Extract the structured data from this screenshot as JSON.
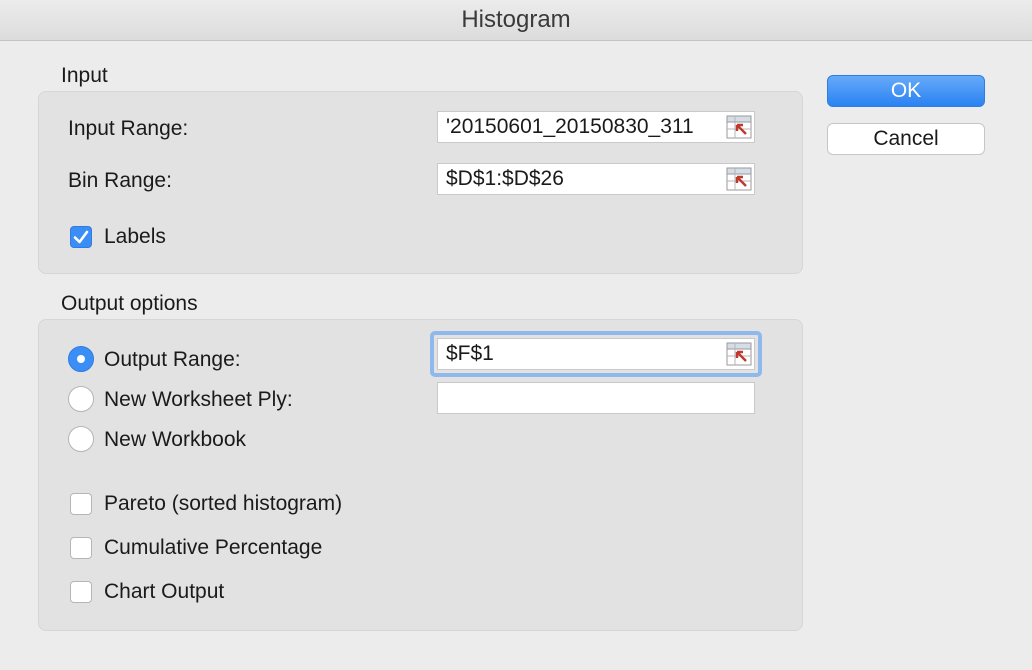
{
  "window": {
    "title": "Histogram"
  },
  "buttons": {
    "ok": "OK",
    "cancel": "Cancel"
  },
  "input_section": {
    "label": "Input",
    "input_range_label": "Input Range:",
    "input_range_value": "'20150601_20150830_311",
    "bin_range_label": "Bin Range:",
    "bin_range_value": "$D$1:$D$26",
    "labels_checkbox": {
      "label": "Labels",
      "checked": true
    }
  },
  "output_section": {
    "label": "Output options",
    "output_range": {
      "label": "Output Range:",
      "selected": true,
      "value": "$F$1"
    },
    "new_worksheet_ply": {
      "label": "New Worksheet Ply:",
      "selected": false,
      "value": ""
    },
    "new_workbook": {
      "label": "New Workbook",
      "selected": false
    },
    "pareto": {
      "label": "Pareto (sorted histogram)",
      "checked": false
    },
    "cumulative_percentage": {
      "label": "Cumulative Percentage",
      "checked": false
    },
    "chart_output": {
      "label": "Chart Output",
      "checked": false
    }
  },
  "colors": {
    "accent": "#3b8ef5",
    "focus": "#8fb9ec",
    "panel": "#e2e2e2",
    "window": "#ececec"
  },
  "icons": {
    "range_picker": "range-select-icon",
    "check": "checkmark-icon"
  }
}
